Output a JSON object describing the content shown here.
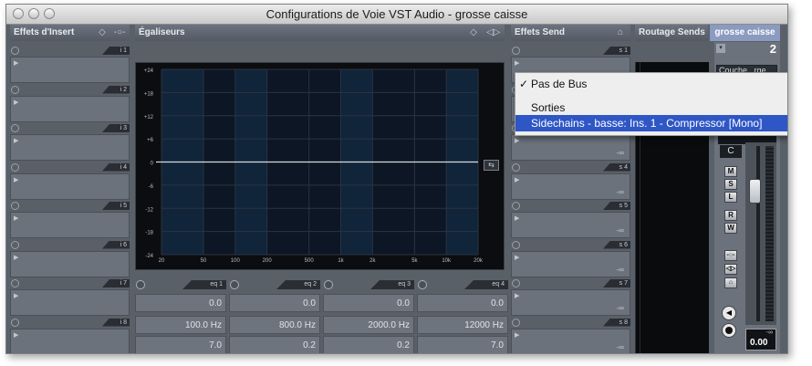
{
  "window": {
    "title": "Configurations de Voie VST Audio - grosse caisse"
  },
  "inserts": {
    "header": "Effets d'Insert",
    "slots": [
      "i 1",
      "i 2",
      "i 3",
      "i 4",
      "i 5",
      "i 6",
      "i 7",
      "i 8"
    ]
  },
  "equalizers": {
    "header": "Égaliseurs",
    "db_labels": [
      "+24",
      "+18",
      "+12",
      "+6",
      "0",
      "-6",
      "-12",
      "-18",
      "-24"
    ],
    "freq_labels": [
      "20",
      "50",
      "100",
      "200",
      "500",
      "1k",
      "2k",
      "5k",
      "10k",
      "20k"
    ],
    "bands": [
      {
        "label": "eq 1",
        "gain": "0.0",
        "freq": "100.0 Hz",
        "q": "7.0"
      },
      {
        "label": "eq 2",
        "gain": "0.0",
        "freq": "800.0 Hz",
        "q": "0.2"
      },
      {
        "label": "eq 3",
        "gain": "0.0",
        "freq": "2000.0 Hz",
        "q": "0.2"
      },
      {
        "label": "eq 4",
        "gain": "0.0",
        "freq": "12000 Hz",
        "q": "7.0"
      }
    ]
  },
  "sends": {
    "header": "Effets Send",
    "slots": [
      "s 1",
      "s 2",
      "s 3",
      "s 4",
      "s 5",
      "s 6",
      "s 7",
      "s 8"
    ],
    "value_text": "-∞"
  },
  "routing": {
    "header": "Routage Sends"
  },
  "context_menu": {
    "items": [
      {
        "label": "Pas de Bus",
        "checked": true
      },
      {
        "label": "Sorties",
        "submenu": true
      },
      {
        "label": "Sidechains - basse: Ins. 1 - Compressor [Mono]",
        "selected": true
      }
    ]
  },
  "channel": {
    "name": "grosse caisse",
    "number": "2",
    "input_label": "Couche...rge In",
    "pan_value": "C",
    "buttons": [
      "M",
      "S",
      "L",
      "R",
      "W"
    ],
    "meter_peak": "-∞",
    "fader_value": "0.00"
  }
}
